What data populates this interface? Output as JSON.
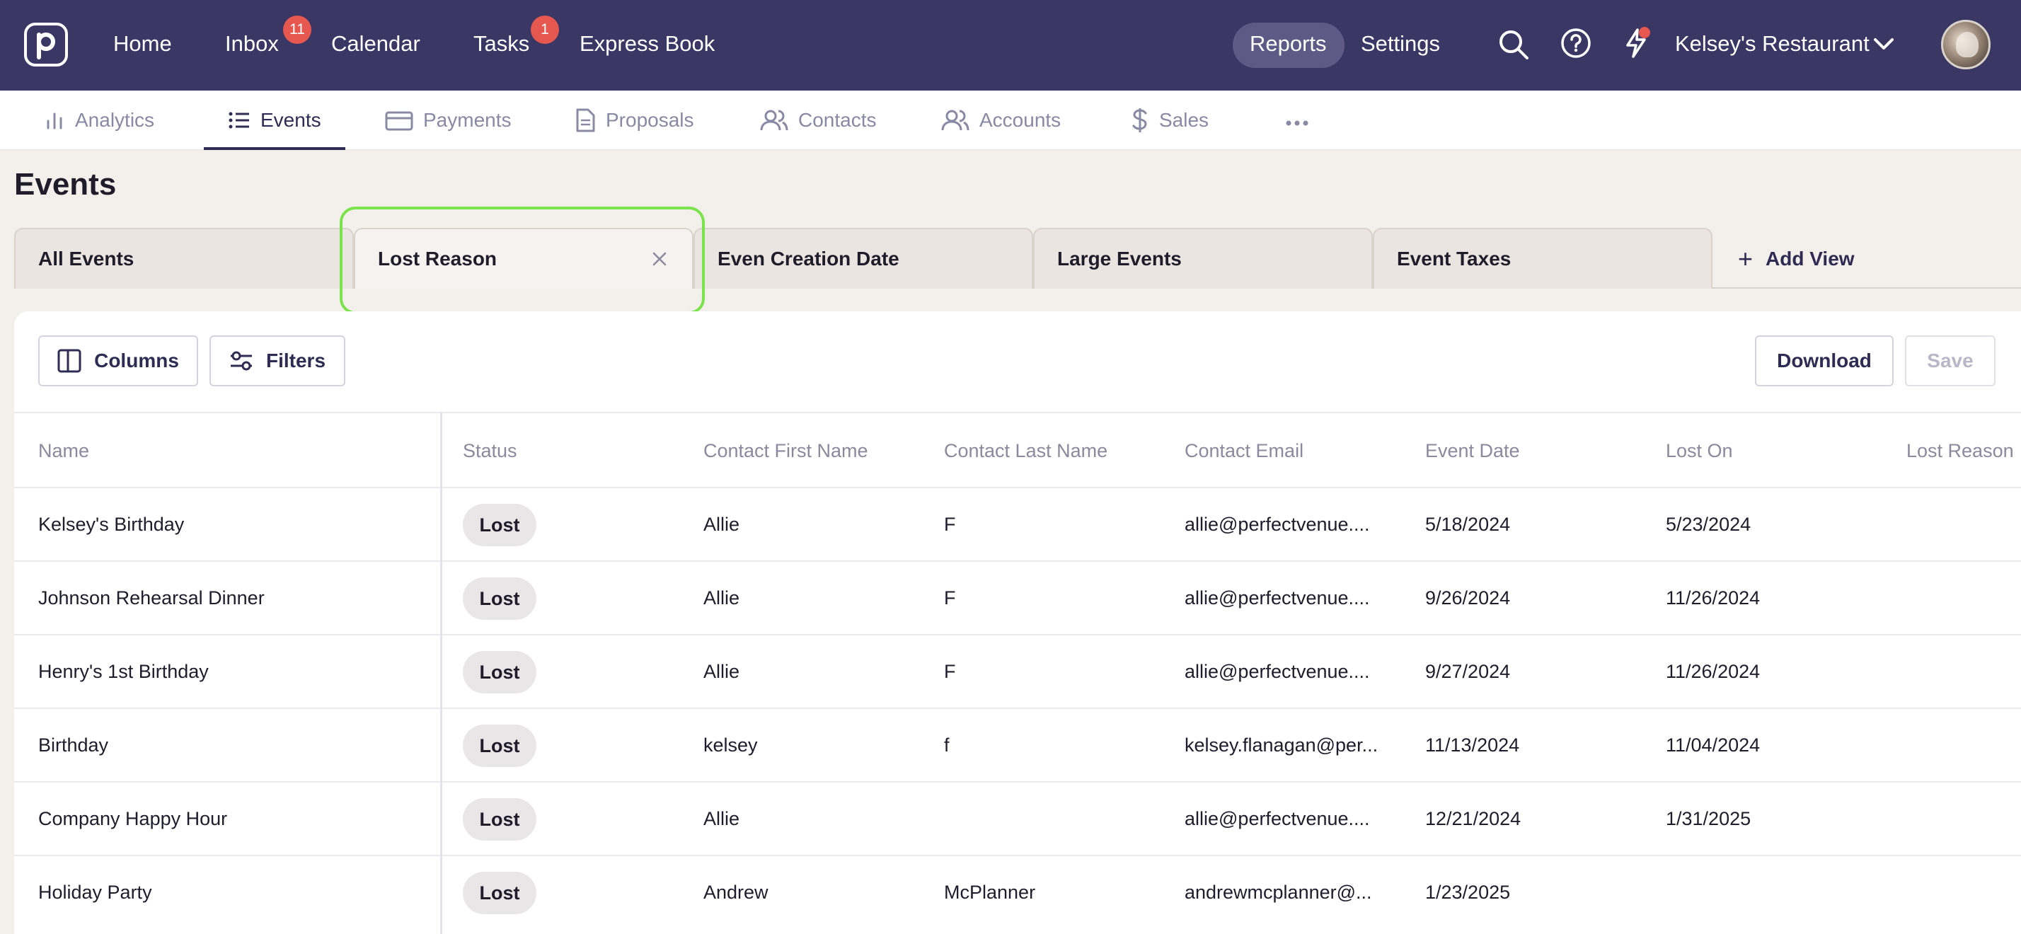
{
  "topnav": {
    "links": {
      "home": "Home",
      "inbox": "Inbox",
      "calendar": "Calendar",
      "tasks": "Tasks",
      "express_book": "Express Book",
      "reports": "Reports",
      "settings": "Settings"
    },
    "inbox_badge": "11",
    "tasks_badge": "1",
    "account_name": "Kelsey's Restaurant"
  },
  "subnav": {
    "tabs": [
      "Analytics",
      "Events",
      "Payments",
      "Proposals",
      "Contacts",
      "Accounts",
      "Sales"
    ],
    "active": "Events"
  },
  "page": {
    "title": "Events"
  },
  "views": {
    "tabs": [
      "All Events",
      "Lost Reason",
      "Even Creation Date",
      "Large Events",
      "Event Taxes"
    ],
    "active": "Lost Reason",
    "add_label": "Add View"
  },
  "toolbar": {
    "columns_label": "Columns",
    "filters_label": "Filters",
    "download_label": "Download",
    "save_label": "Save"
  },
  "table": {
    "columns": [
      "Name",
      "Status",
      "Contact First Name",
      "Contact Last Name",
      "Contact Email",
      "Event Date",
      "Lost On",
      "Lost Reason"
    ],
    "rows": [
      {
        "name": "Kelsey's Birthday",
        "status": "Lost",
        "first": "Allie",
        "last": "F",
        "email": "allie@perfectvenue....",
        "event_date": "5/18/2024",
        "lost_on": "5/23/2024",
        "reason": ""
      },
      {
        "name": "Johnson Rehearsal Dinner",
        "status": "Lost",
        "first": "Allie",
        "last": "F",
        "email": "allie@perfectvenue....",
        "event_date": "9/26/2024",
        "lost_on": "11/26/2024",
        "reason": ""
      },
      {
        "name": "Henry's 1st Birthday",
        "status": "Lost",
        "first": "Allie",
        "last": "F",
        "email": "allie@perfectvenue....",
        "event_date": "9/27/2024",
        "lost_on": "11/26/2024",
        "reason": ""
      },
      {
        "name": "Birthday",
        "status": "Lost",
        "first": "kelsey",
        "last": "f",
        "email": "kelsey.flanagan@per...",
        "event_date": "11/13/2024",
        "lost_on": "11/04/2024",
        "reason": ""
      },
      {
        "name": "Company Happy Hour",
        "status": "Lost",
        "first": "Allie",
        "last": "",
        "email": "allie@perfectvenue....",
        "event_date": "12/21/2024",
        "lost_on": "1/31/2025",
        "reason": ""
      },
      {
        "name": "Holiday Party",
        "status": "Lost",
        "first": "Andrew",
        "last": "McPlanner",
        "email": "andrewmcplanner@...",
        "event_date": "1/23/2025",
        "lost_on": "",
        "reason": ""
      }
    ]
  },
  "colors": {
    "topbar": "#3b3764",
    "accent": "#2f2c54",
    "badge": "#e5574f",
    "highlight": "#7be44c"
  }
}
